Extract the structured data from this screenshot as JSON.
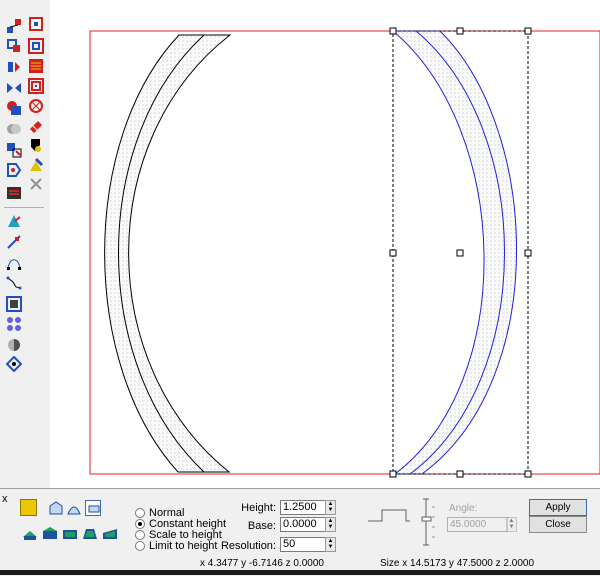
{
  "toolbar": {
    "left_icons": [
      "node-select-icon",
      "transform-icon",
      "mirror-icon",
      "weld-icon",
      "intersect-icon",
      "trim-icon",
      "group-icon",
      "break-apart-icon",
      "align-icon",
      "fill-icon",
      "knife-icon",
      "bezier-icon",
      "polyline-icon",
      "contour-icon",
      "blend-icon",
      "envelope-icon",
      "distort-icon"
    ],
    "right_icons": [
      "square-node-icon",
      "layers-icon",
      "square-stack-icon",
      "spiral-icon",
      "circle-target-icon",
      "eraser-icon",
      "shaper-icon",
      "color-dropper-icon",
      "scissors-icon"
    ]
  },
  "panel": {
    "close_glyph": "x",
    "color": "#e8c800",
    "modes": [
      {
        "label": "Normal",
        "selected": false
      },
      {
        "label": "Constant height",
        "selected": true
      },
      {
        "label": "Scale to height",
        "selected": false
      },
      {
        "label": "Limit to height",
        "selected": false
      }
    ],
    "height_label": "Height:",
    "height_value": "1.2500",
    "base_label": "Base:",
    "base_value": "0.0000",
    "resolution_label": "Resolution:",
    "resolution_value": "50",
    "angle_label": "Angle:",
    "angle_value": "45.0000",
    "apply_label": "Apply",
    "close_label": "Close"
  },
  "status": {
    "cursor": "x 4.3477 y -6.7146 z 0.0000",
    "size": "Size x 14.5173 y 47.5000 z 2.0000"
  }
}
